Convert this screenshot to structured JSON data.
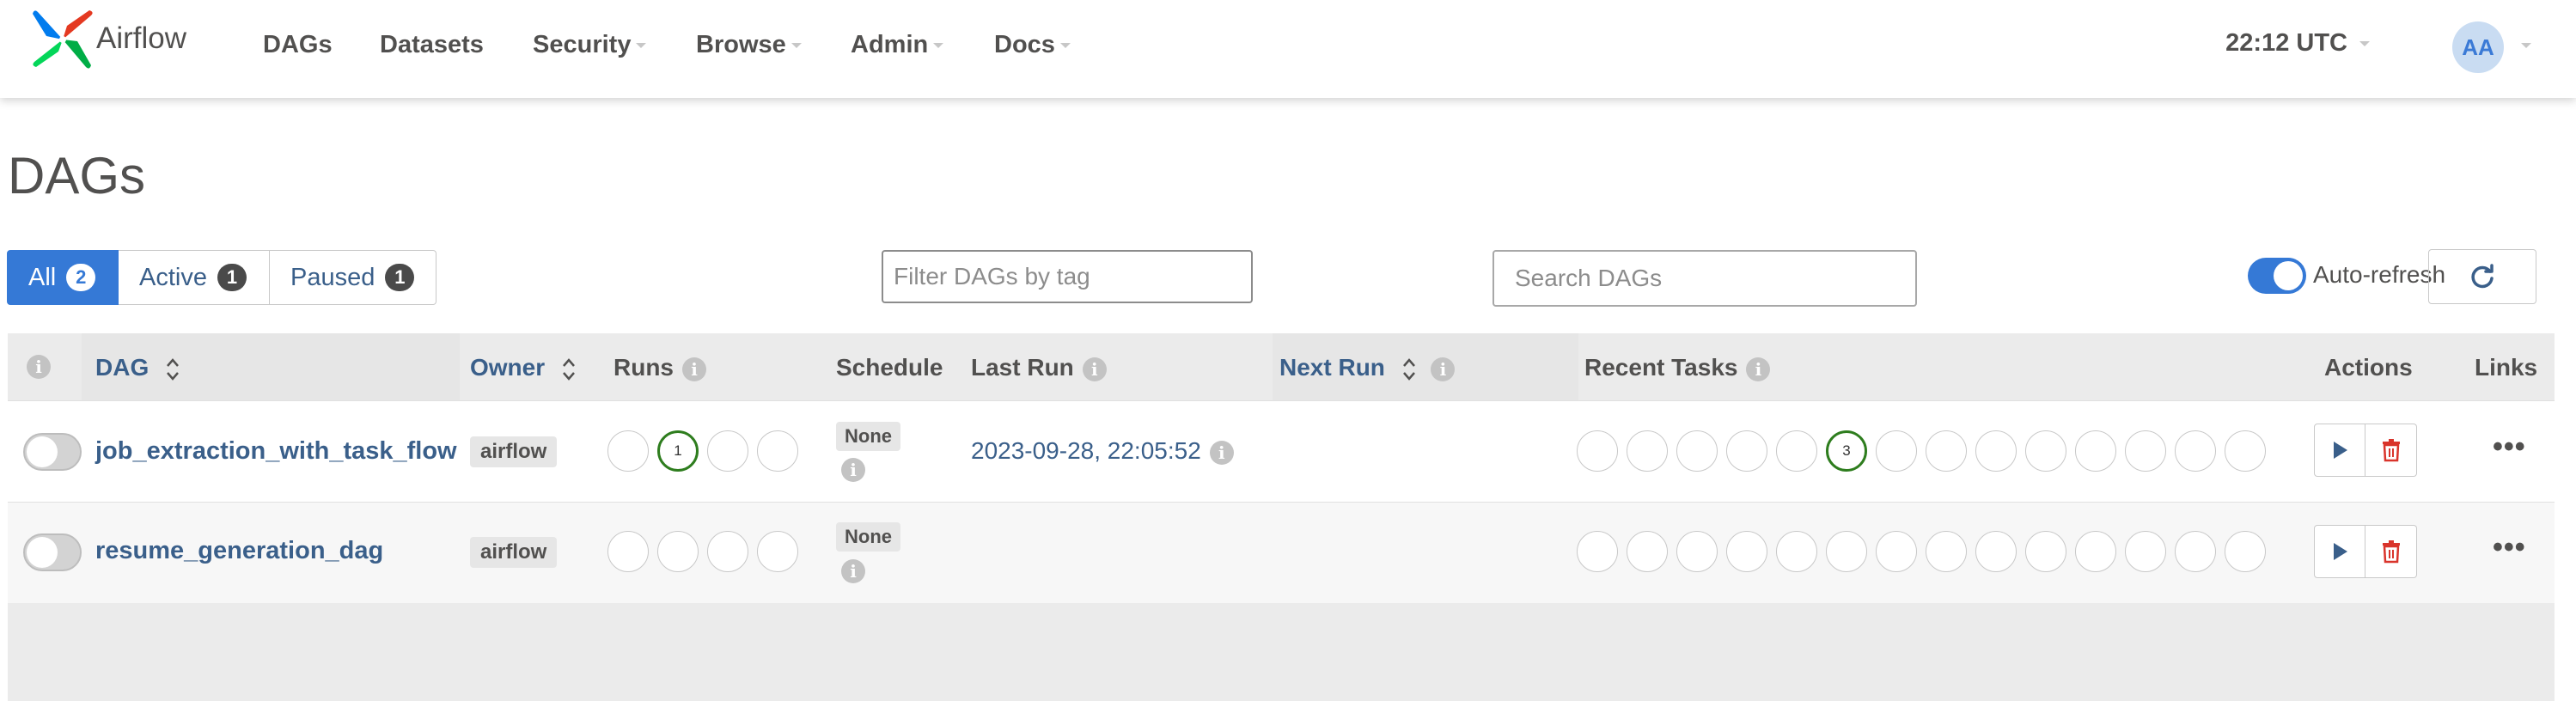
{
  "navbar": {
    "brand": "Airflow",
    "items": [
      {
        "label": "DAGs",
        "dropdown": false
      },
      {
        "label": "Datasets",
        "dropdown": false
      },
      {
        "label": "Security",
        "dropdown": true
      },
      {
        "label": "Browse",
        "dropdown": true
      },
      {
        "label": "Admin",
        "dropdown": true
      },
      {
        "label": "Docs",
        "dropdown": true
      }
    ],
    "clock": "22:12 UTC",
    "avatar_initials": "AA"
  },
  "page": {
    "title": "DAGs"
  },
  "filters": {
    "tabs": [
      {
        "label": "All",
        "count": "2",
        "active": true
      },
      {
        "label": "Active",
        "count": "1",
        "active": false
      },
      {
        "label": "Paused",
        "count": "1",
        "active": false
      }
    ],
    "tag_placeholder": "Filter DAGs by tag",
    "search_placeholder": "Search DAGs",
    "auto_refresh_label": "Auto-refresh",
    "auto_refresh_on": true
  },
  "table": {
    "headers": {
      "dag": "DAG",
      "owner": "Owner",
      "runs": "Runs",
      "schedule": "Schedule",
      "last_run": "Last Run",
      "next_run": "Next Run",
      "recent_tasks": "Recent Tasks",
      "actions": "Actions",
      "links": "Links"
    },
    "rows": [
      {
        "dag_id": "job_extraction_with_task_flow",
        "paused": true,
        "owner": "airflow",
        "runs": {
          "success_count": "1"
        },
        "schedule": "None",
        "last_run": "2023-09-28, 22:05:52",
        "next_run": "",
        "recent_tasks": {
          "success_count": "3"
        }
      },
      {
        "dag_id": "resume_generation_dag",
        "paused": true,
        "owner": "airflow",
        "runs": {
          "success_count": ""
        },
        "schedule": "None",
        "last_run": "",
        "next_run": "",
        "recent_tasks": {
          "success_count": ""
        }
      }
    ]
  },
  "colors": {
    "primary": "#3579d6",
    "link": "#3a5f8a",
    "success": "#2e7d1e",
    "delete": "#d9342b"
  },
  "icons": {
    "play": "play-icon",
    "delete": "trash-icon",
    "refresh": "refresh-icon",
    "more": "more-icon",
    "info": "info-icon"
  }
}
